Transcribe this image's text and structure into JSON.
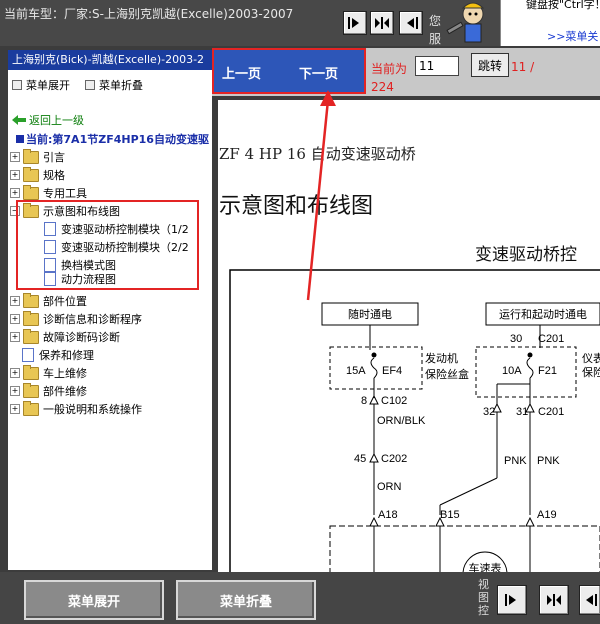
{
  "topbar": {
    "car_model": "当前车型：厂家:S-上海别克凯越(Excelle)2003-2007",
    "service_text": "您服",
    "help_text": "键盘按\"Ctrl字！",
    "menu_link": ">>菜单关"
  },
  "sidebar": {
    "header": "上海别克(Bick)-凯越(Excelle)-2003-2",
    "expand_label": "菜单展开",
    "collapse_label": "菜单折叠",
    "back_label": "返回上一级",
    "current": "当前:第7A1节ZF4HP16自动变速驱",
    "tree": [
      {
        "label": "引言",
        "type": "folder"
      },
      {
        "label": "规格",
        "type": "folder"
      },
      {
        "label": "专用工具",
        "type": "folder"
      },
      {
        "label": "示意图和布线图",
        "type": "folder-open"
      },
      {
        "label": "变速驱动桥控制模块（1/2",
        "type": "doc"
      },
      {
        "label": "变速驱动桥控制模块（2/2",
        "type": "doc"
      },
      {
        "label": "换档模式图",
        "type": "doc"
      },
      {
        "label": "动力流程图",
        "type": "doc"
      },
      {
        "label": "部件位置",
        "type": "folder"
      },
      {
        "label": "诊断信息和诊断程序",
        "type": "folder"
      },
      {
        "label": "故障诊断码诊断",
        "type": "folder"
      },
      {
        "label": "保养和修理",
        "type": "doc"
      },
      {
        "label": "车上维修",
        "type": "folder"
      },
      {
        "label": "部件维修",
        "type": "folder"
      },
      {
        "label": "一般说明和系统操作",
        "type": "folder"
      }
    ]
  },
  "pager": {
    "prev_label": "上一页",
    "next_label": "下一页",
    "current_label": "当前为",
    "page_value": "11",
    "goto_label": "跳转",
    "total_a": "11 /",
    "total_b": "224"
  },
  "document": {
    "section": "ZF 4 HP 16 自动变速驱动桥",
    "title": "示意图和布线图",
    "diagram_title": "变速驱动桥控",
    "diagram": {
      "box1": "随时通电",
      "box2": "运行和起动时通电",
      "fuse1": "15A",
      "fuse1_id": "EF4",
      "fuse1_desc_a": "发动机",
      "fuse1_desc_b": "保险丝盒",
      "fuse2": "10A",
      "fuse2_id": "F21",
      "fuse2_desc_a": "仪表",
      "fuse2_desc_b": "保险",
      "c201_top": "30",
      "c201_label": "C201",
      "c102_pin": "8",
      "c102": "C102",
      "wire1": "ORN/BLK",
      "c202_pin": "45",
      "c202": "C202",
      "wire2": "ORN",
      "pin32": "32",
      "pin31": "31",
      "c201b": "C201",
      "pnk1": "PNK",
      "pnk2": "PNK",
      "a18": "A18",
      "b15": "B15",
      "a19": "A19",
      "sensor": "车速表"
    }
  },
  "bottom": {
    "expand_label": "菜单展开",
    "collapse_label": "菜单折叠",
    "view_ctrl": "视图控"
  },
  "colors": {
    "accent_blue": "#2d56b8",
    "highlight_red": "#e32424",
    "sidebar_header": "#1a3c9e"
  }
}
